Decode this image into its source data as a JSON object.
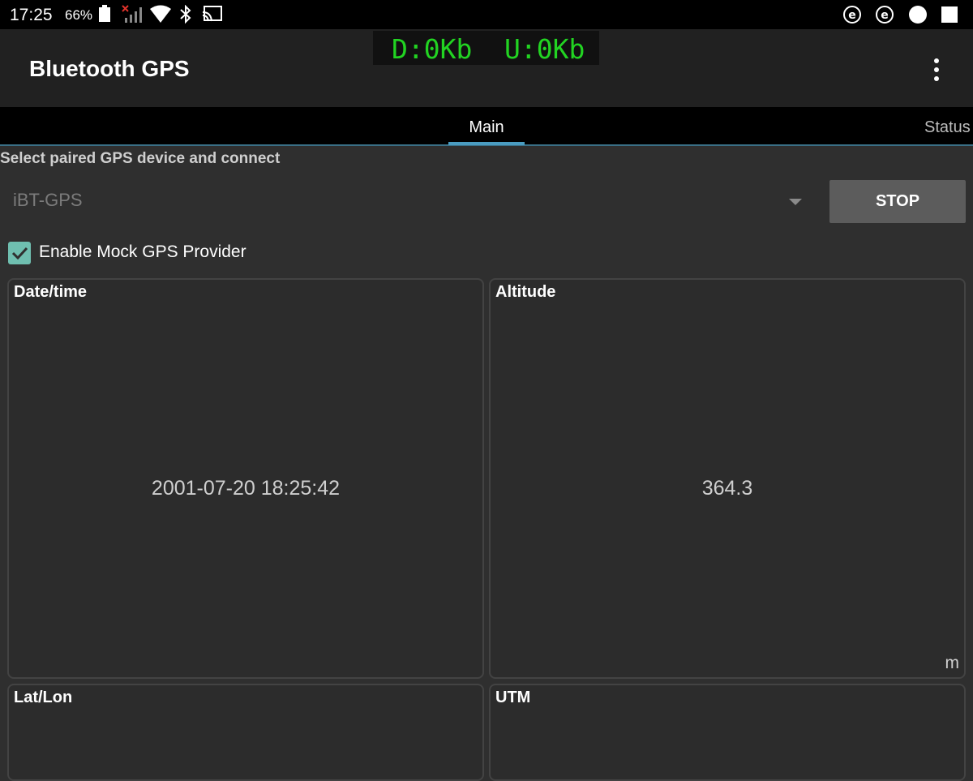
{
  "status_bar": {
    "time": "17:25",
    "battery": "66%",
    "icons": [
      "battery-icon",
      "no-signal-icon",
      "wifi-icon",
      "bluetooth-icon",
      "cast-icon",
      "e-notification-icon",
      "e-notification-icon",
      "circle-notification-icon",
      "square-notification-icon"
    ]
  },
  "toolbar": {
    "title": "Bluetooth GPS",
    "download": "D:0Kb",
    "upload": "U:0Kb",
    "menu_icon": "more-vert-icon"
  },
  "tabs": [
    {
      "label": "Main",
      "selected": true
    },
    {
      "label": "Status",
      "selected": false
    }
  ],
  "main": {
    "section_label": "Select paired GPS device and connect",
    "device": "iBT-GPS",
    "stop_label": "STOP",
    "mock_checkbox_label": "Enable Mock GPS Provider",
    "mock_checked": true
  },
  "cards": {
    "datetime": {
      "title": "Date/time",
      "value": "2001-07-20 18:25:42"
    },
    "altitude": {
      "title": "Altitude",
      "value": "364.3",
      "unit": "m"
    },
    "latlon": {
      "title": "Lat/Lon"
    },
    "utm": {
      "title": "UTM"
    }
  },
  "colors": {
    "accent": "#4a9cc1",
    "traffic_text": "#22d422",
    "checkbox": "#6fbfb0"
  }
}
